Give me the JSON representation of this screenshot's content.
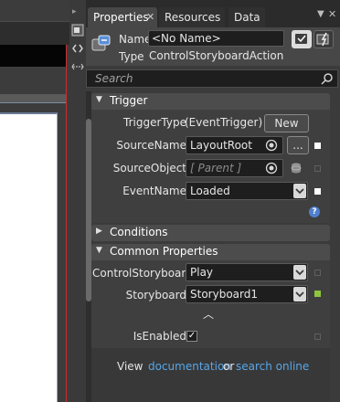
{
  "tabs": [
    {
      "label": "Properties",
      "close": "✕"
    },
    {
      "label": "Resources"
    },
    {
      "label": "Data"
    }
  ],
  "tab_controls": {
    "pin_icon": "pin-icon",
    "close_icon": "close-icon"
  },
  "header": {
    "name_label": "Name",
    "name_value": "<No Name>",
    "type_label": "Type",
    "type_value": "ControlStoryboardAction"
  },
  "search": {
    "placeholder": "Search"
  },
  "sections": {
    "trigger": {
      "title": "Trigger",
      "trigger_type_label": "TriggerType",
      "trigger_type_value": "(EventTrigger)",
      "new_button": "New",
      "source_name_label": "SourceName",
      "source_name_value": "LayoutRoot",
      "browse_button": "...",
      "source_object_label": "SourceObject",
      "source_object_value": "[ Parent ]",
      "event_name_label": "EventName",
      "event_name_value": "Loaded",
      "help": "?"
    },
    "conditions": {
      "title": "Conditions"
    },
    "common": {
      "title": "Common Properties",
      "control_label": "ControlStoryboar...",
      "control_value": "Play",
      "storyboard_label": "Storyboard",
      "storyboard_value": "Storyboard1",
      "collapse_glyph": "︿",
      "is_enabled_label": "IsEnabled",
      "is_enabled_check": "✓"
    }
  },
  "footer": {
    "view": "View",
    "documentation": "documentation",
    "or": "or",
    "search_online": "search online"
  },
  "colors": {
    "accent_link": "#58a6e8",
    "marker_green": "#8cc63f",
    "artboard_border": "#c83030"
  }
}
